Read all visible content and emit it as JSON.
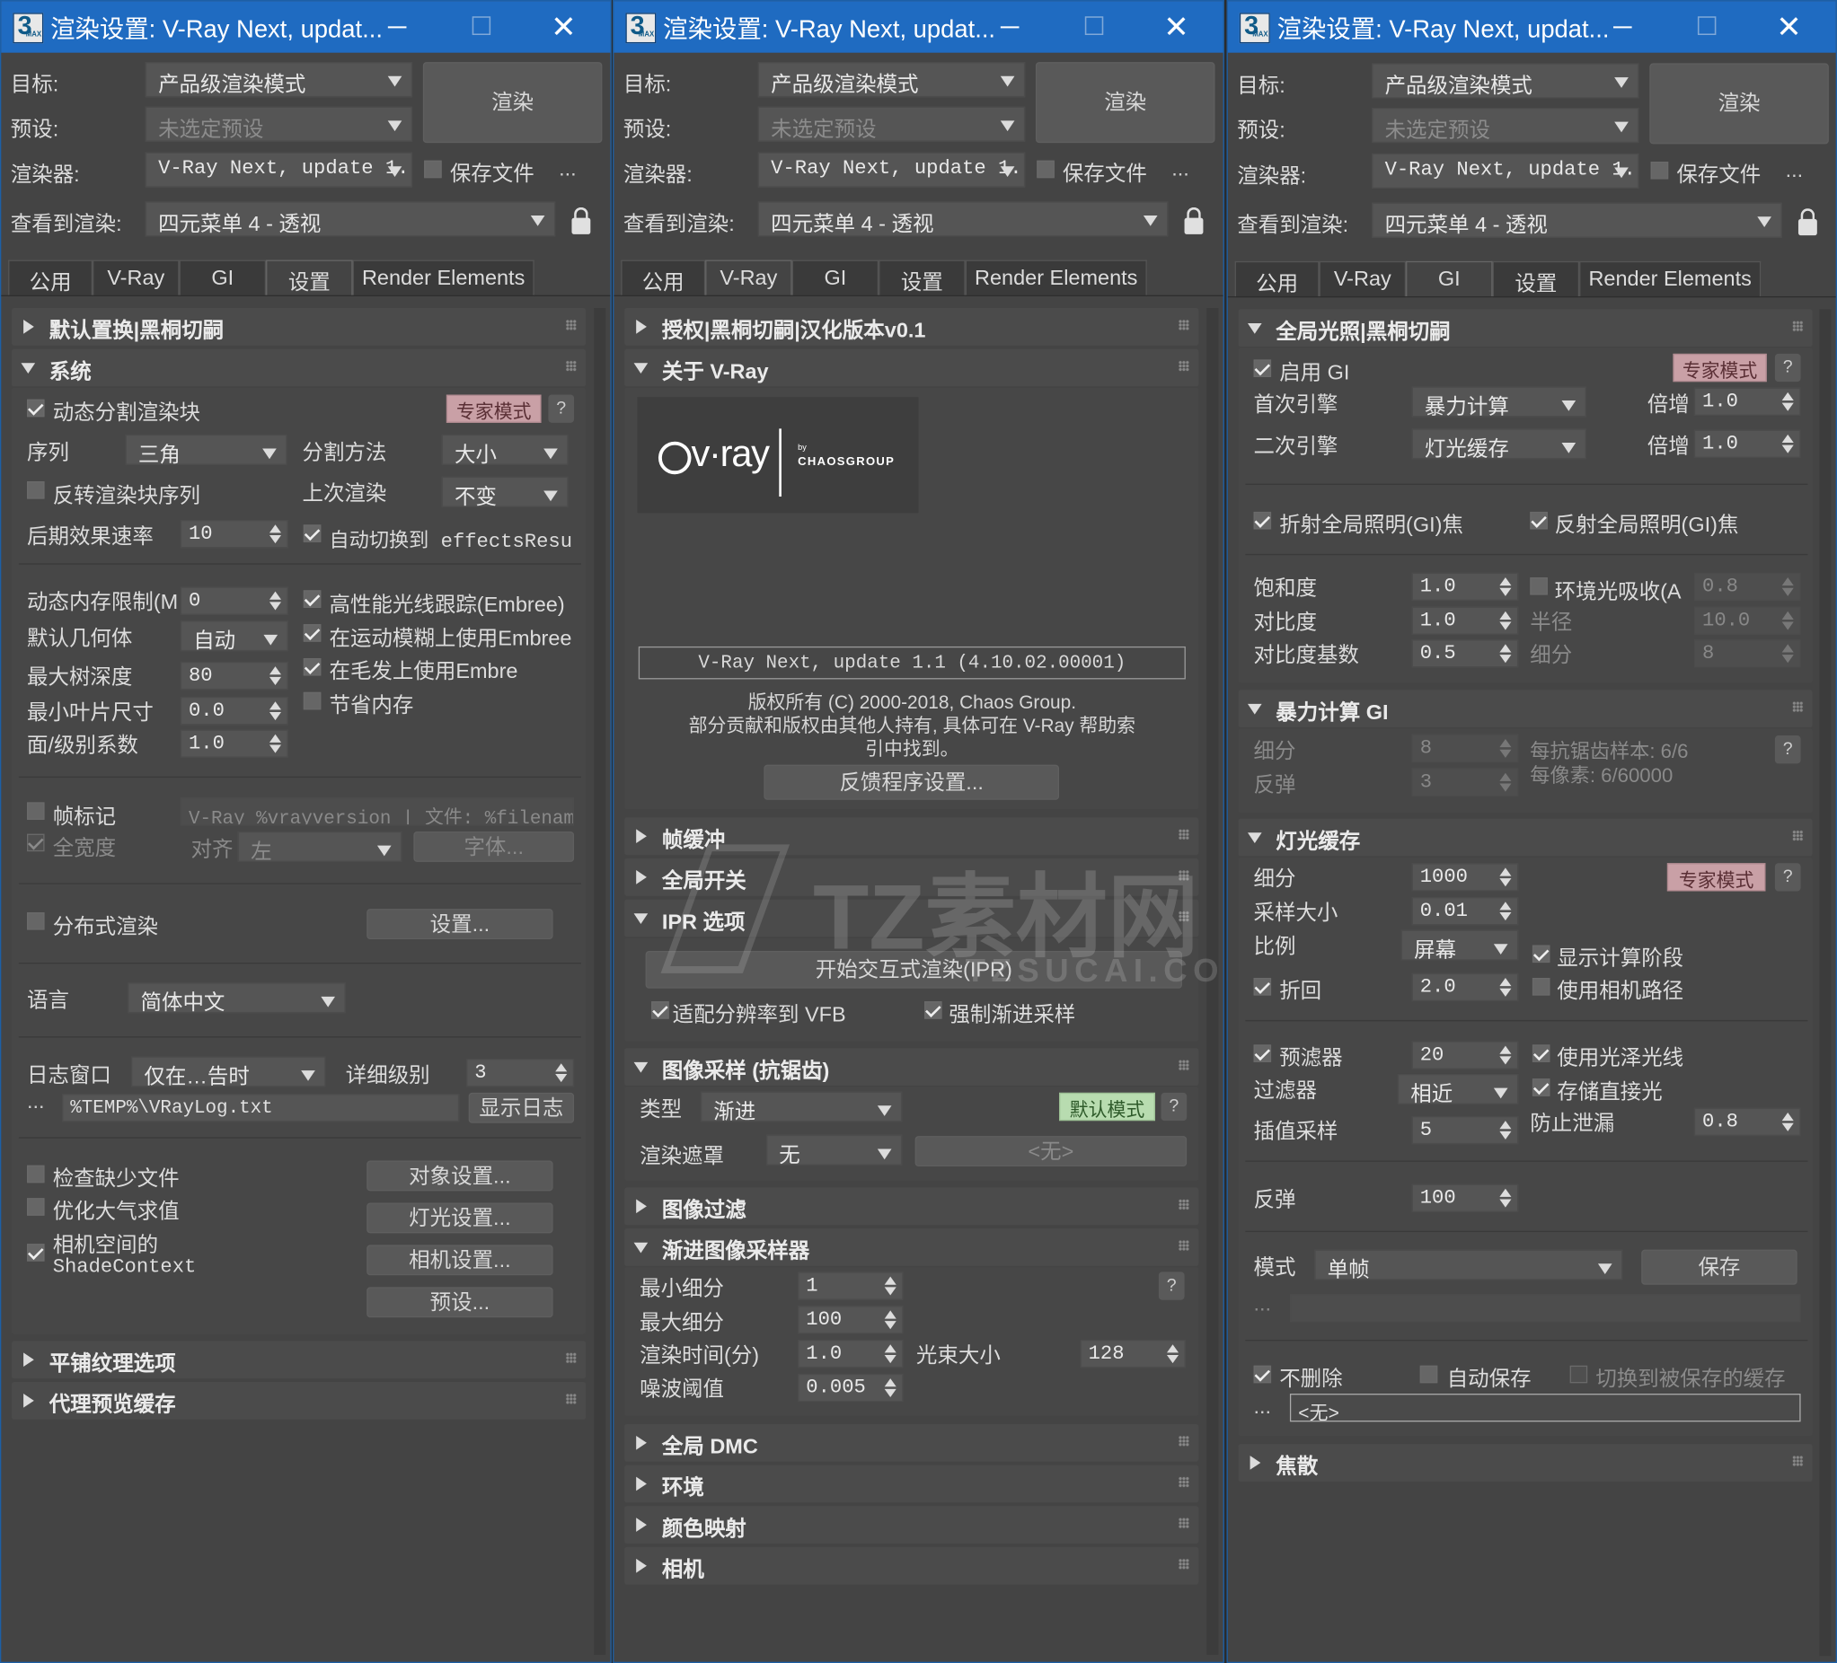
{
  "title": "渲染设置: V-Ray Next, updat...",
  "win_min": "─",
  "win_max": "☐",
  "win_close": "✕",
  "lbl_target": "目标:",
  "lbl_preset": "预设:",
  "lbl_renderer": "渲染器:",
  "lbl_view": "查看到渲染:",
  "target_value": "产品级渲染模式",
  "preset_value": "未选定预设",
  "renderer_value": "V-Ray Next, update 1.",
  "view_value": "四元菜单 4 - 透视",
  "render_btn": "渲染",
  "save_file": "保存文件",
  "dots": "...",
  "tabs": [
    "公用",
    "V-Ray",
    "GI",
    "设置",
    "Render Elements"
  ],
  "colors": {
    "titlebar": "#1f6bc1",
    "panel": "#444444",
    "expert_badge": "#c9a0a6",
    "default_badge": "#b8dcb0"
  },
  "icons": [
    "app-icon",
    "minimize-icon",
    "maximize-icon",
    "close-icon",
    "lock-icon",
    "dropdown-arrow-icon",
    "expand-triangle-icon",
    "grip-icon",
    "checkbox-icon",
    "help-icon",
    "vray-logo"
  ],
  "w1": {
    "sec_default": "默认置换|黑桐切嗣",
    "sec_system": "系统",
    "dyn_split": "动态分割渲染块",
    "expert": "专家模式",
    "q": "?",
    "seq": "序列",
    "seq_val": "三角",
    "split_method": "分割方法",
    "split_val": "大小",
    "reverse": "反转渲染块序列",
    "last_render": "上次渲染",
    "last_val": "不变",
    "post_rate": "后期效果速率",
    "post_val": "10",
    "auto_switch": "自动切换到 effectsResu",
    "dyn_mem": "动态内存限制(M",
    "dyn_mem_val": "0",
    "hp_ray": "高性能光线跟踪(Embree)",
    "def_geo": "默认几何体",
    "def_geo_val": "自动",
    "motion_blur": "在运动模糊上使用Embree",
    "max_tree": "最大树深度",
    "max_tree_val": "80",
    "hair": "在毛发上使用Embre",
    "min_leaf": "最小叶片尺寸",
    "min_leaf_val": "0.0",
    "save_mem": "节省内存",
    "face_coef": "面/级别系数",
    "face_coef_val": "1.0",
    "frame_stamp": "帧标记",
    "stamp_text": "V-Ray %vrayversion | 文件: %filename",
    "full_width": "全宽度",
    "align": "对齐",
    "align_val": "左",
    "font_btn": "字体...",
    "distributed": "分布式渲染",
    "settings_btn": "设置...",
    "lang": "语言",
    "lang_val": "简体中文",
    "log_win": "日志窗口",
    "log_val": "仅在…告时",
    "detail": "详细级别",
    "detail_val": "3",
    "log_path": "%TEMP%\\VRayLog.txt",
    "show_log": "显示日志",
    "check_missing": "检查缺少文件",
    "obj_settings": "对象设置...",
    "optimize_atm": "优化大气求值",
    "light_settings": "灯光设置...",
    "cam_space": "相机空间的",
    "shade_context": "ShadeContext",
    "cam_settings": "相机设置...",
    "presets_btn": "预设...",
    "sec_tile": "平铺纹理选项",
    "sec_proxy": "代理预览缓存"
  },
  "w2": {
    "sec_license": "授权|黑桐切嗣|汉化版本v0.1",
    "sec_about": "关于 V-Ray",
    "logo_vray": "v·ray",
    "logo_by": "by",
    "logo_chaos": "CHAOSGROUP",
    "version": "V-Ray Next, update 1.1 (4.10.02.00001)",
    "copyright": "版权所有 (C) 2000-2018, Chaos Group.",
    "contrib1": "部分贡献和版权由其他人持有, 具体可在 V-Ray 帮助索",
    "contrib2": "引中找到。",
    "feedback": "反馈程序设置...",
    "sec_fb": "帧缓冲",
    "sec_global": "全局开关",
    "sec_ipr": "IPR 选项",
    "start_ipr": "开始交互式渲染(IPR)",
    "fit_res": "适配分辨率到 VFB",
    "force_prog": "强制渐进采样",
    "sec_sampler": "图像采样 (抗锯齿)",
    "type": "类型",
    "type_val": "渐进",
    "default_mode": "默认模式",
    "q": "?",
    "mask": "渲染遮罩",
    "mask_val": "无",
    "mask_none": "<无>",
    "sec_filter": "图像过滤",
    "sec_prog": "渐进图像采样器",
    "min_sub": "最小细分",
    "min_sub_val": "1",
    "max_sub": "最大细分",
    "max_sub_val": "100",
    "render_time": "渲染时间(分)",
    "render_time_val": "1.0",
    "bundle": "光束大小",
    "bundle_val": "128",
    "noise": "噪波阈值",
    "noise_val": "0.005",
    "sec_dmc": "全局 DMC",
    "sec_env": "环境",
    "sec_cmap": "颜色映射",
    "sec_cam": "相机"
  },
  "w3": {
    "sec_gi": "全局光照|黑桐切嗣",
    "enable_gi": "启用 GI",
    "expert": "专家模式",
    "q": "?",
    "primary": "首次引擎",
    "primary_val": "暴力计算",
    "mult": "倍增",
    "primary_mult": "1.0",
    "secondary": "二次引擎",
    "secondary_val": "灯光缓存",
    "secondary_mult": "1.0",
    "refr_caustics": "折射全局照明(GI)焦‪",
    "refl_caustics": "反射全局照明(GI)焦",
    "saturation": "饱和度",
    "sat_val": "1.0",
    "ao": "环境光吸收(A",
    "ao_val": "0.8",
    "contrast": "对比度",
    "con_val": "1.0",
    "radius": "半径",
    "radius_val": "10.0",
    "contrast_base": "对比度基数",
    "base_val": "0.5",
    "subdiv": "细分",
    "subdiv_val": "8",
    "sec_bf": "暴力计算 GI",
    "bf_subdiv": "细分",
    "bf_subdiv_val": "8",
    "bf_bounce": "反弹",
    "bf_bounce_val": "3",
    "aa_samples": "每抗锯齿样本: 6/6",
    "px_samples": "每像素: 6/60000",
    "sec_lc": "灯光缓存",
    "lc_subdiv": "细分",
    "lc_subdiv_val": "1000",
    "sample_size": "采样大小",
    "sample_size_val": "0.01",
    "scale": "比例",
    "scale_val": "屏幕",
    "show_calc": "显示计算阶段",
    "retrace": "折回",
    "retrace_val": "2.0",
    "use_cam_path": "使用相机路径",
    "prefilter": "预滤器",
    "prefilter_val": "20",
    "use_gloss": "使用光泽光线",
    "filter": "过滤器",
    "filter_val": "相近",
    "store_direct": "存储直接光",
    "interp": "插值采样",
    "interp_val": "5",
    "leak": "防止泄漏",
    "leak_val": "0.8",
    "bounces": "反弹",
    "bounces_val": "100",
    "mode": "模式",
    "mode_val": "单帧",
    "save_btn": "保存",
    "dont_delete": "不删除",
    "auto_save": "自动保存",
    "switch_saved": "切换到被保存的缓存",
    "none": "<无>",
    "sec_caustics": "焦散"
  },
  "watermark": {
    "main": "TZ素材网",
    "url": "TZSUCAI.COM"
  }
}
